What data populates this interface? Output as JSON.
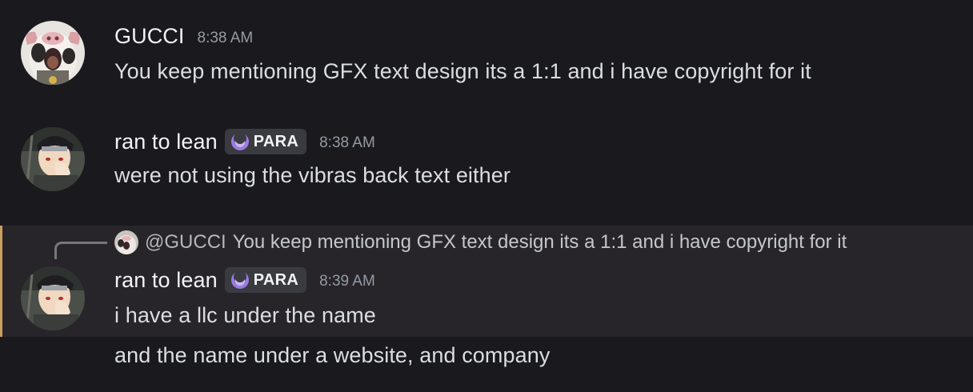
{
  "messages": [
    {
      "username": "GUCCI",
      "timestamp": "8:38 AM",
      "text": "You keep mentioning GFX text design its a 1:1 and i have copyright for it",
      "avatar_icon": "cow-avatar-icon"
    },
    {
      "username": "ran to lean",
      "tag": "PARA",
      "timestamp": "8:38 AM",
      "text": "were not using the vibras back text either",
      "avatar_icon": "anime-character-avatar-icon"
    },
    {
      "reply": {
        "mention": "@GUCCI",
        "text": "You keep mentioning GFX text design its a 1:1 and i have copyright for it"
      },
      "username": "ran to lean",
      "tag": "PARA",
      "timestamp": "8:39 AM",
      "text": "i have a llc under the name",
      "followup": "and the name under a website, and company",
      "avatar_icon": "anime-character-avatar-icon"
    }
  ],
  "colors": {
    "background": "#1a1a1e",
    "highlight": "#27252a",
    "highlight_bar": "#c9a060",
    "tag_bg": "#3a3b41",
    "tag_icon": "#9b7be0"
  }
}
